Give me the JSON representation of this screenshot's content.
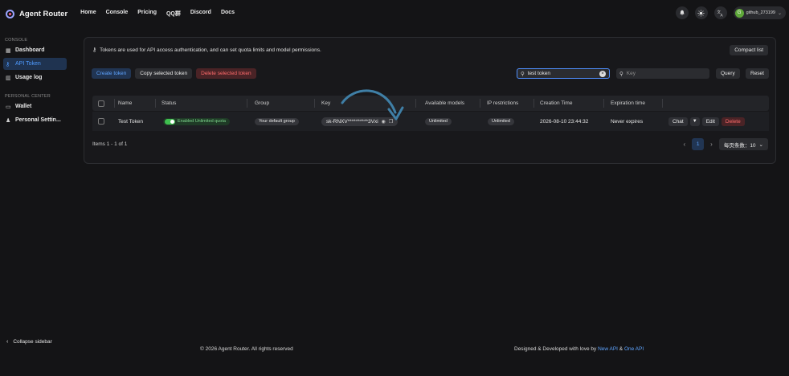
{
  "brand": {
    "name": "Agent Router"
  },
  "nav": [
    "Home",
    "Console",
    "Pricing",
    "QQ群",
    "Discord",
    "Docs"
  ],
  "user": {
    "initial": "G",
    "name": "github_273199"
  },
  "sidebar": {
    "console_label": "CONSOLE",
    "console_items": [
      {
        "label": "Dashboard",
        "icon": "dashboard-icon"
      },
      {
        "label": "API Token",
        "icon": "key-icon"
      },
      {
        "label": "Usage log",
        "icon": "chart-icon"
      }
    ],
    "personal_label": "PERSONAL CENTER",
    "personal_items": [
      {
        "label": "Wallet",
        "icon": "wallet-icon"
      },
      {
        "label": "Personal Settin...",
        "icon": "user-icon"
      }
    ],
    "collapse_label": "Collapse sidebar"
  },
  "info_text": "Tokens are used for API access authentication, and can set quota limits and model permissions.",
  "buttons": {
    "compact": "Compact list",
    "create": "Create token",
    "copy": "Copy selected token",
    "delete": "Delete selected token",
    "query": "Query",
    "reset": "Reset"
  },
  "search": {
    "value": "test token",
    "key_placeholder": "Key"
  },
  "table": {
    "headers": [
      "Name",
      "Status",
      "Group",
      "Key",
      "Available models",
      "IP restrictions",
      "Creation Time",
      "Expiration time"
    ],
    "rows": [
      {
        "name": "Test Token",
        "status": "Enabled Unlimited quota",
        "group": "Your default group",
        "key": "sk-RNXV**********3Vxi",
        "models": "Unlimited",
        "ip": "Unlimited",
        "created": "2026-08-10 23:44:32",
        "expires": "Never expires",
        "actions": {
          "chat": "Chat",
          "edit": "Edit",
          "delete": "Delete"
        }
      }
    ]
  },
  "pagination": {
    "summary": "Items 1 - 1 of 1",
    "current_page": "1",
    "page_size": "每页条数：10"
  },
  "footer": {
    "copyright": "© 2026 Agent Router. All rights reserved",
    "credit_prefix": "Designed & Developed with love by ",
    "link1": "New API",
    "amp": " & ",
    "link2": "One API"
  },
  "colors": {
    "accent": "#4f9bff",
    "danger": "#ff6b6b",
    "success": "#3fbf4f",
    "annotation": "#3f7fa6"
  }
}
